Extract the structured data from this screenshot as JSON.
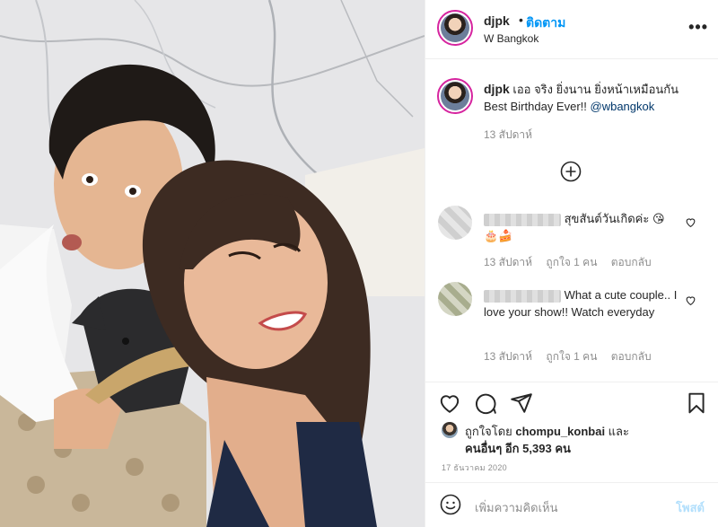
{
  "header": {
    "username": "djpk",
    "separator": "•",
    "follow_label": "ติดตาม",
    "location": "W Bangkok",
    "more_label": "•••"
  },
  "caption": {
    "username": "djpk",
    "text": " เออ จริง ยิ่งนาน ยิ่งหน้าเหมือนกัน Best Birthday Ever!! ",
    "mention": "@wbangkok",
    "time": "13 สัปดาห์"
  },
  "comments": [
    {
      "text": "สุขสันต์วันเกิดค่ะ 😘",
      "emoji_line": "🎂🍰",
      "time": "13 สัปดาห์",
      "likes": "ถูกใจ 1 คน",
      "reply": "ตอบกลับ"
    },
    {
      "text": "What a cute couple.. I love your show!! Watch everyday",
      "time": "13 สัปดาห์",
      "likes": "ถูกใจ 1 คน",
      "reply": "ตอบกลับ"
    }
  ],
  "likes": {
    "prefix": "ถูกใจโดย ",
    "user": "chompu_konbai",
    "suffix": " และ",
    "others_prefix": "คนอื่นๆ อีก ",
    "others_count": "5,393",
    "others_suffix": " คน"
  },
  "post_date": "17 ธันวาคม 2020",
  "add_comment": {
    "placeholder": "เพิ่มความคิดเห็น",
    "post_label": "โพสต์"
  },
  "icons": [
    "heart-icon",
    "comment-icon",
    "share-icon",
    "bookmark-icon",
    "plus-circle-icon",
    "emoji-icon",
    "more-icon"
  ],
  "colors": {
    "link": "#0095f6",
    "mention": "#00376b",
    "muted": "#8e8e8e",
    "post_disabled": "#b2dffc"
  }
}
